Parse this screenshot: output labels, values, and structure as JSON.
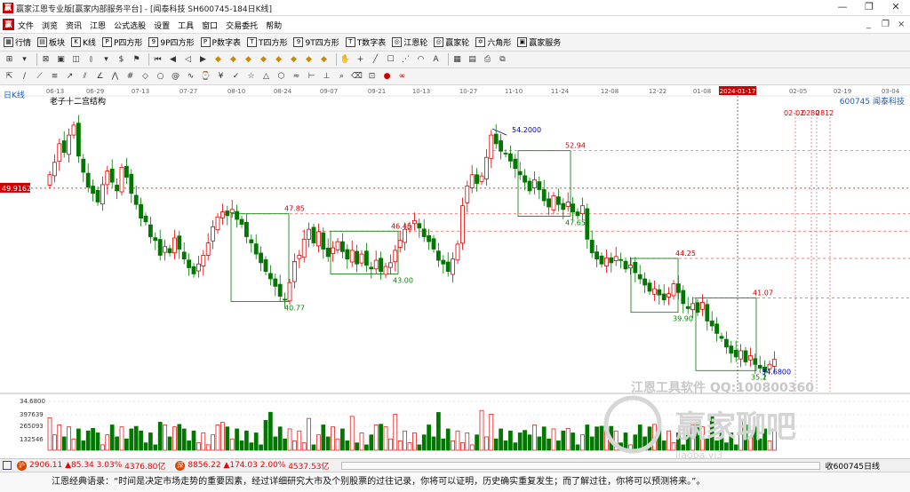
{
  "window": {
    "title": "赢家江恩专业版[赢家内部服务平台] - [闻泰科技  SH600745-184日K线]",
    "minimize": "—",
    "restore": "❐",
    "close": "✕"
  },
  "menu": {
    "logo": "赢",
    "items": [
      "文件",
      "浏览",
      "资讯",
      "江恩",
      "公式选股",
      "设置",
      "工具",
      "窗口",
      "交易委托",
      "帮助"
    ],
    "right_controls": [
      "_",
      "❐",
      "×"
    ]
  },
  "toolbar1": [
    {
      "icon": "▦",
      "label": "行情"
    },
    {
      "icon": "▤",
      "label": "板块"
    },
    {
      "icon": "K",
      "label": "K线"
    },
    {
      "icon": "P",
      "label": "P四方形"
    },
    {
      "icon": "9",
      "label": "9P四方形"
    },
    {
      "icon": "P",
      "label": "P数字表"
    },
    {
      "icon": "T",
      "label": "T四方形"
    },
    {
      "icon": "9",
      "label": "9T四方形"
    },
    {
      "icon": "T",
      "label": "T数字表"
    },
    {
      "icon": "◎",
      "label": "江恩轮"
    },
    {
      "icon": "◎",
      "label": "赢家轮"
    },
    {
      "icon": "✡",
      "label": "六角形"
    },
    {
      "icon": "▣",
      "label": "赢家服务"
    }
  ],
  "chart_header": {
    "period": "日K线",
    "subtitle": "老子十二宫结构",
    "stock": "600745  闻泰科技",
    "price_tag": "49.9162"
  },
  "chart_data": {
    "type": "candlestick",
    "stock_code": "600745",
    "stock_name": "闻泰科技",
    "period": "日K线",
    "date_ticks": [
      "06-13",
      "06-29",
      "07-13",
      "07-27",
      "08-10",
      "08-24",
      "09-07",
      "09-21",
      "10-13",
      "10-27",
      "11-10",
      "11-24",
      "12-08",
      "12-22",
      "01-08",
      "2024-01-17",
      "02-05",
      "02-19",
      "03-04"
    ],
    "highlighted_date": "2024-01-17",
    "future_dates": [
      "02-02",
      "0280",
      "2812"
    ],
    "ylim": [
      33.5,
      56.5
    ],
    "closes": [
      51.0,
      52.0,
      53.5,
      52.8,
      54.2,
      55.0,
      52.5,
      51.2,
      50.0,
      49.5,
      48.8,
      50.2,
      51.3,
      50.4,
      49.7,
      51.6,
      50.8,
      49.5,
      48.6,
      47.5,
      47.2,
      46.0,
      45.7,
      44.5,
      45.2,
      44.7,
      45.9,
      45.0,
      44.2,
      43.5,
      43.0,
      43.8,
      44.5,
      45.5,
      46.8,
      47.6,
      48.0,
      47.7,
      48.2,
      47.4,
      47.0,
      46.0,
      45.5,
      44.6,
      43.9,
      43.2,
      42.6,
      42.0,
      41.2,
      40.9,
      42.3,
      44.0,
      44.5,
      45.8,
      46.6,
      45.5,
      46.4,
      45.0,
      44.4,
      45.1,
      45.6,
      44.8,
      44.2,
      44.9,
      43.8,
      44.6,
      43.7,
      43.4,
      44.1,
      43.2,
      43.6,
      43.9,
      44.9,
      45.7,
      46.6,
      46.9,
      47.3,
      46.7,
      46.0,
      45.6,
      45.0,
      44.1,
      43.8,
      43.2,
      44.2,
      45.4,
      48.5,
      50.1,
      51.0,
      50.3,
      50.9,
      52.4,
      54.2,
      53.5,
      52.9,
      52.7,
      52.1,
      51.5,
      51.0,
      50.4,
      49.7,
      50.6,
      49.8,
      48.9,
      48.4,
      49.3,
      48.6,
      48.2,
      48.8,
      48.0,
      47.7,
      48.5,
      45.8,
      44.7,
      44.2,
      43.8,
      44.3,
      43.9,
      44.4,
      44.1,
      43.4,
      43.7,
      43.1,
      42.6,
      42.1,
      41.6,
      41.8,
      41.3,
      40.9,
      41.4,
      42.2,
      41.5,
      40.6,
      40.2,
      40.6,
      39.9,
      40.7,
      39.2,
      38.8,
      38.2,
      37.8,
      37.1,
      36.6,
      36.3,
      36.8,
      35.9,
      36.4,
      35.7,
      35.4,
      35.1,
      35.7,
      36.1
    ],
    "annotations": [
      {
        "label": "54.2000",
        "value": 54.2
      },
      {
        "label": "52.94",
        "value": 52.94
      },
      {
        "label": "47.85",
        "value": 47.85
      },
      {
        "label": "46.45",
        "value": 46.45
      },
      {
        "label": "47.65",
        "value": 47.65
      },
      {
        "label": "43.00",
        "value": 43.0
      },
      {
        "label": "40.77",
        "value": 40.77
      },
      {
        "label": "44.25",
        "value": 44.25
      },
      {
        "label": "39.90",
        "value": 39.9
      },
      {
        "label": "41.07",
        "value": 41.07
      },
      {
        "label": "35.2",
        "value": 35.2
      },
      {
        "label": "34.6800",
        "value": 34.68
      }
    ],
    "volume": {
      "labels": [
        "34.6800",
        "397639",
        "265093",
        "132546"
      ],
      "ylim": [
        0,
        530000
      ]
    },
    "colors": {
      "up": "#e00000",
      "down": "#007800",
      "box": "#007800",
      "grid": "#d0d0d0"
    }
  },
  "watermark": {
    "line1": "江恩工具软件  QQ:100800360",
    "line2": "赢家聊吧",
    "line3": "liaoba.yj3"
  },
  "status": {
    "sh": {
      "label": "沪",
      "value": "2906.11",
      "change": "▲85.34",
      "pct": "3.03%",
      "amount": "4376.80亿"
    },
    "sz": {
      "label": "深",
      "value": "8856.22",
      "change": "▲174.03",
      "pct": "2.00%",
      "amount": "4537.53亿"
    },
    "right_text": "收600745日线"
  },
  "quote": "江恩经典语录：“时间是决定市场走势的重要因素，经过详细研究大市及个别股票的过往记录，你将可以证明，历史确实重复发生；而了解过往，你将可以预测将来。”。"
}
